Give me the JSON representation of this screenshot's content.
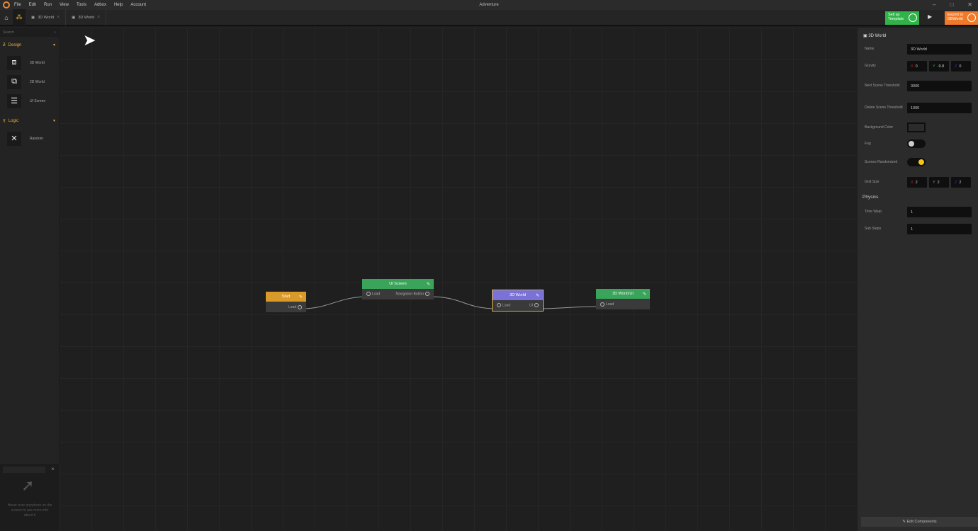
{
  "window": {
    "title": "Adventure"
  },
  "menu": [
    "File",
    "Edit",
    "Run",
    "View",
    "Tools",
    "Adbox",
    "Help",
    "Account"
  ],
  "tabs": [
    {
      "label": "3D World"
    },
    {
      "label": "3D World"
    }
  ],
  "toolbar": {
    "sell_label_1": "Sell as",
    "sell_label_2": "Template",
    "export_label_1": "Export to",
    "export_label_2": "BBWorld"
  },
  "sidebar": {
    "search_placeholder": "Search",
    "sections": [
      {
        "label": "Design",
        "items": [
          "3D World",
          "2D World",
          "UI Screen"
        ]
      },
      {
        "label": "Logic",
        "items": [
          "Random"
        ]
      }
    ],
    "help_text": "Hover over anywhere on the screen to see more info about it"
  },
  "nodes": [
    {
      "title": "Start",
      "color": "#d99a2a",
      "ports_out": "Load"
    },
    {
      "title": "UI Screen",
      "color": "#3aa55a",
      "port_in": "Load",
      "ports_out": "Navigation Button"
    },
    {
      "title": "3D World",
      "color": "#7a72d8",
      "port_in": "Load",
      "ports_out": "UI"
    },
    {
      "title": "3D World UI",
      "color": "#3aa55a",
      "port_in": "Load"
    }
  ],
  "props": {
    "title": "3D World",
    "name_label": "Name",
    "name_value": "3D World",
    "gravity_label": "Gravity",
    "gravity": {
      "x": "0",
      "y": "-9.8",
      "z": "0"
    },
    "next_label": "Next Scene Threshold",
    "next_value": "3000",
    "delete_label": "Delete Scene Threshold",
    "delete_value": "1000",
    "bg_label": "Background Color",
    "fog_label": "Fog",
    "fog_on": false,
    "random_label": "Scenes Randomized",
    "random_on": true,
    "grid_label": "Grid Size",
    "grid": {
      "x": "2",
      "y": "2",
      "z": "2"
    },
    "physics_label": "Physics",
    "timewarp_label": "Time Warp",
    "timewarp_value": "1",
    "substeps_label": "Sub Steps",
    "substeps_value": "1",
    "axis_x": "X",
    "axis_y": "Y",
    "axis_z": "Z",
    "edit_components": "✎ Edit Components"
  }
}
